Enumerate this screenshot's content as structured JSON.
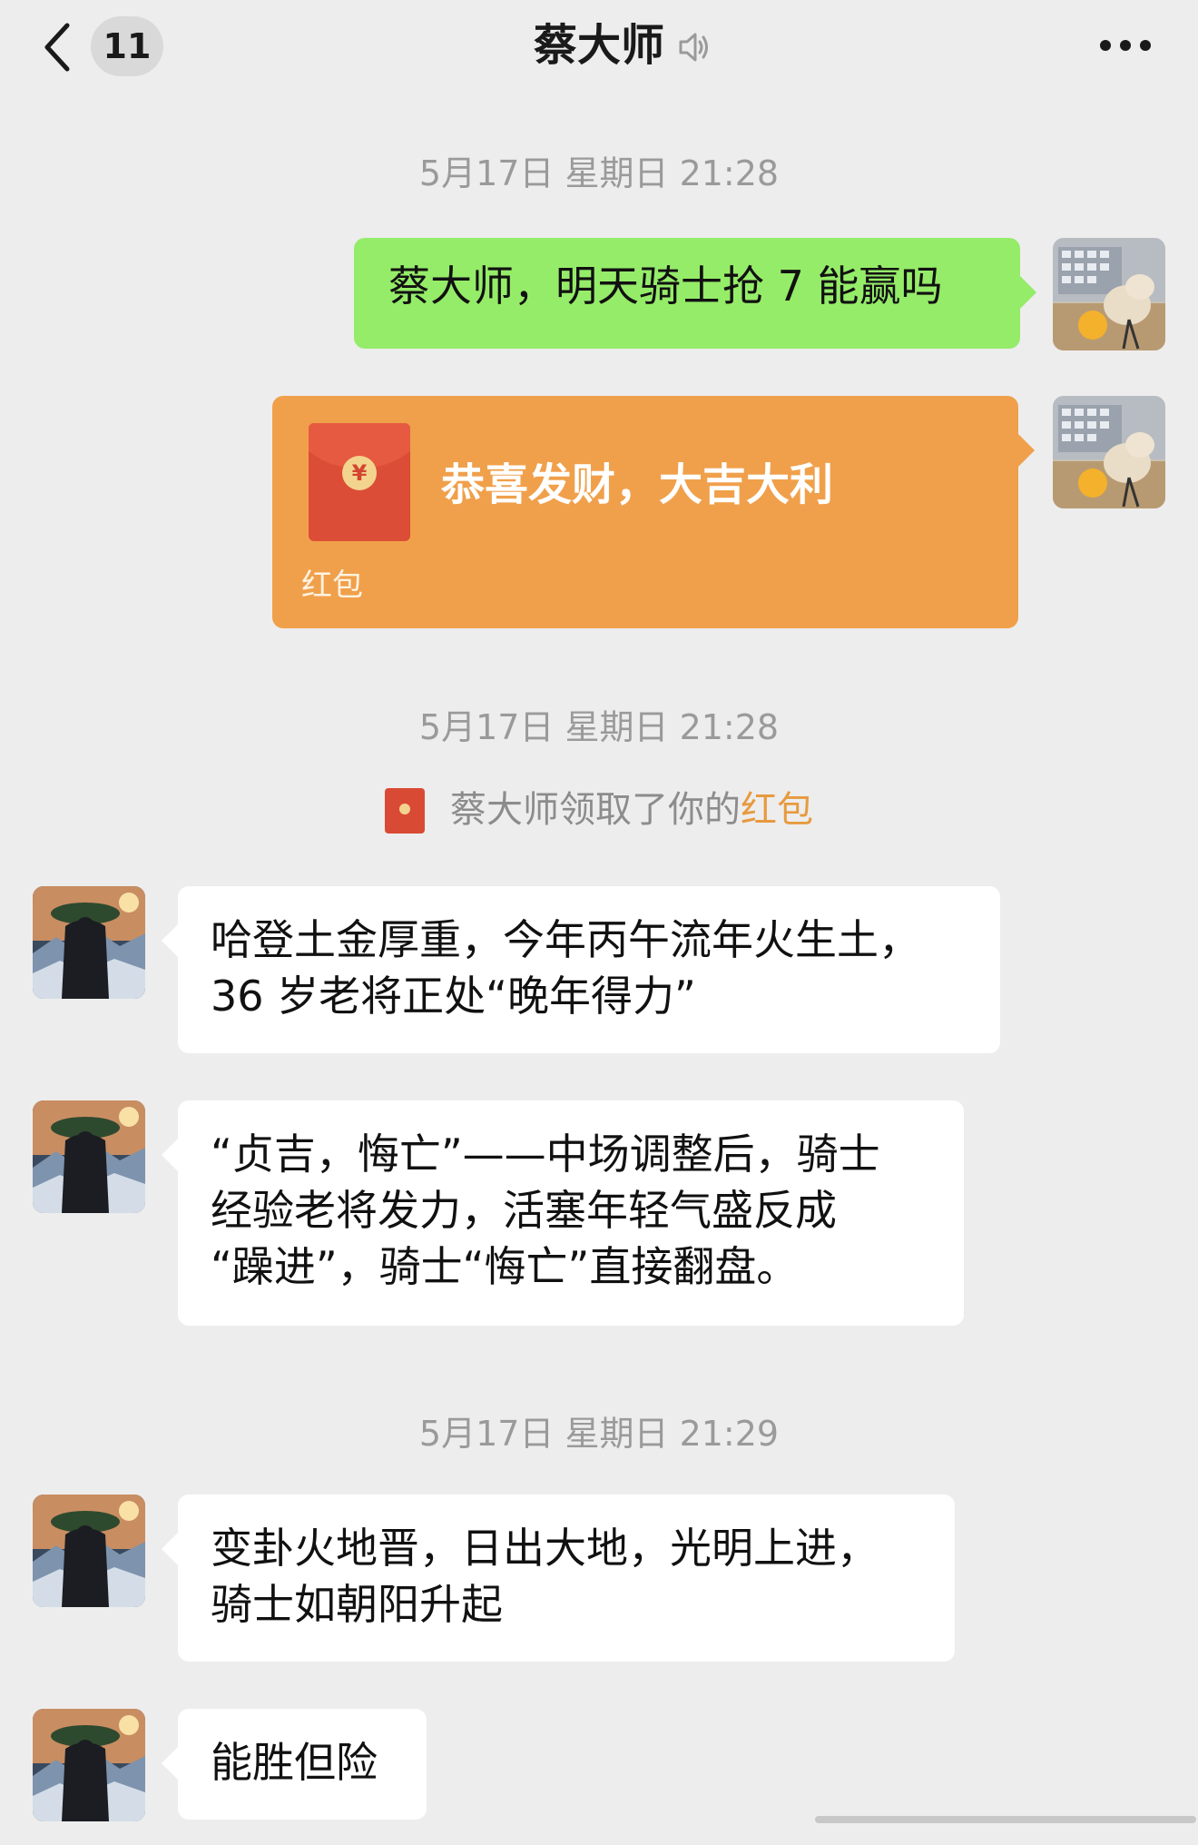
{
  "nav": {
    "back_icon": "chevron-left-icon",
    "unread_count": "11",
    "title": "蔡大师",
    "mute_icon": "muted-speaker-icon",
    "more_icon": "more-dots-icon"
  },
  "messages": {
    "time1": "5月17日 星期日 21:28",
    "outgoing_text": "蔡大师，明天骑士抢 7 能赢吗",
    "red_packet": {
      "coin_symbol": "¥",
      "greeting": "恭喜发财，大吉大利",
      "label": "红包",
      "color": "#f0a04b"
    },
    "time2": "5月17日 星期日 21:28",
    "notice": {
      "prefix": "蔡大师领取了你的",
      "link": "红包"
    },
    "reply1": [
      "哈登土金厚重，今年丙午流年火生土，",
      "36 岁老将正处“晚年得力”"
    ],
    "reply2": [
      "“贞吉，悔亡”——中场调整后，骑士",
      "经验老将发力，活塞年轻气盛反成",
      "“躁进”，骑士“悔亡”直接翻盘。"
    ],
    "time3": "5月17日 星期日 21:29",
    "reply3": [
      "变卦火地晋，日出大地，光明上进，",
      "骑士如朝阳升起"
    ],
    "reply4": "能胜但险"
  },
  "colors": {
    "background": "#ededed",
    "outgoing_bubble": "#95ec69",
    "incoming_bubble": "#ffffff",
    "red_packet_link": "#e79a3f"
  }
}
